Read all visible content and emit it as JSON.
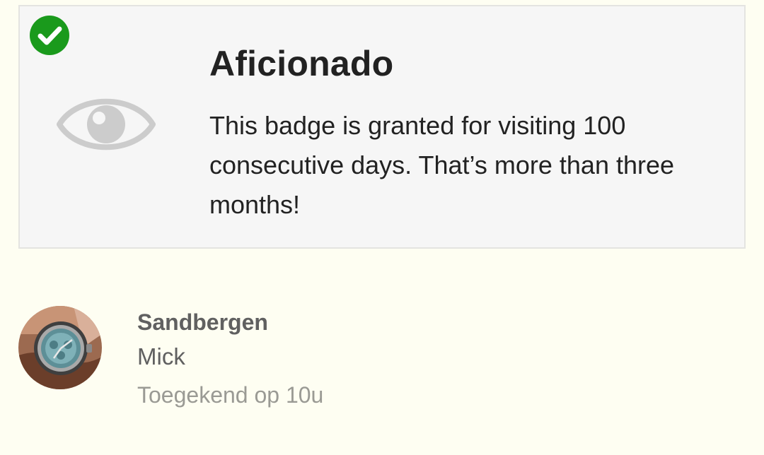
{
  "badge": {
    "title": "Aficionado",
    "description": "This badge is granted for visiting 100 consecutive days. That’s more than three months!",
    "granted_icon": "check-circle-icon",
    "badge_icon": "eye-icon",
    "granted_color": "#1a9a1c",
    "icon_color": "#cccccc"
  },
  "user": {
    "username": "Sandbergen",
    "name": "Mick",
    "granted_text": "Toegekend op 10u",
    "avatar_icon": "wristwatch-photo"
  },
  "colors": {
    "background": "#fefef2",
    "card_background": "#f6f6f6",
    "title_text": "#222222",
    "secondary_text": "#606060",
    "muted_text": "#9a9a94"
  }
}
